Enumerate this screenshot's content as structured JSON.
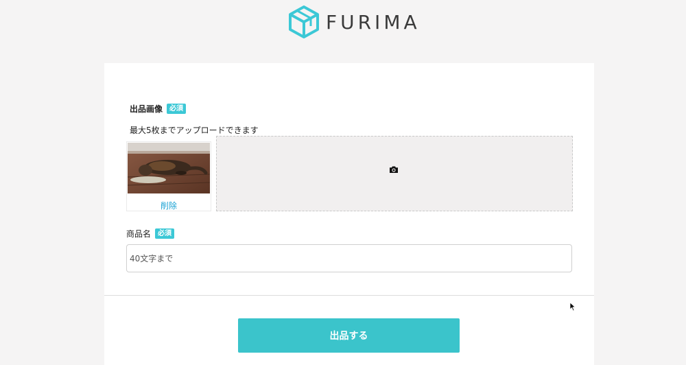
{
  "header": {
    "logo_text": "FURIMA",
    "logo_color": "#3cc8d6"
  },
  "images_section": {
    "label": "出品画像",
    "required_badge": "必須",
    "hint": "最大5枚までアップロードできます",
    "preview": {
      "delete_label": "削除"
    },
    "dropzone_icon": "camera-icon"
  },
  "name_section": {
    "label": "商品名",
    "required_badge": "必須",
    "input_value": "",
    "placeholder": "40文字まで"
  },
  "submit": {
    "label": "出品する",
    "color": "#3bc4cb"
  }
}
